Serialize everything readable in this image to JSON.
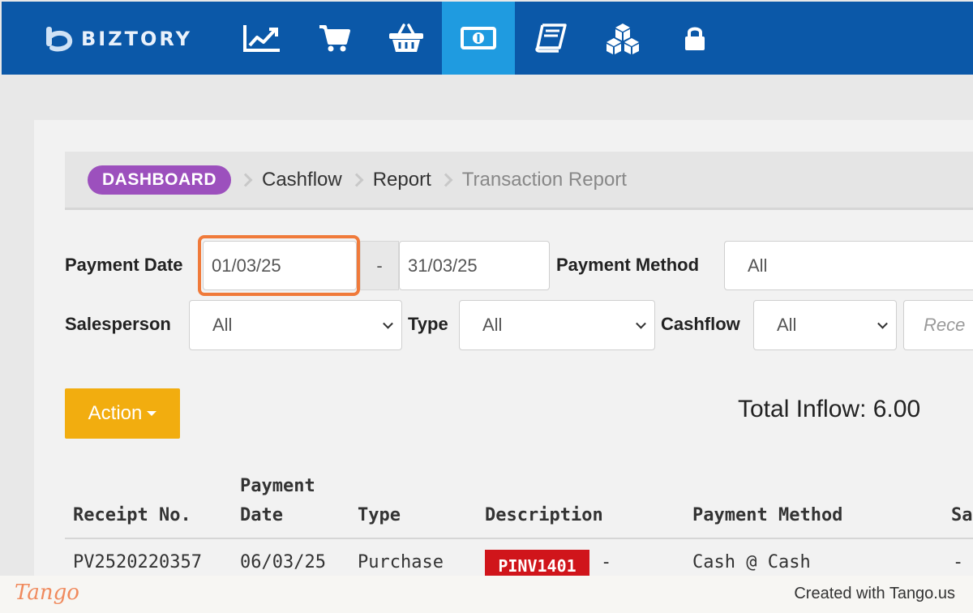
{
  "app": {
    "brand": "BIZTORY"
  },
  "nav": [
    {
      "icon": "chart-line-icon",
      "active": false
    },
    {
      "icon": "shopping-cart-icon",
      "active": false
    },
    {
      "icon": "basket-icon",
      "active": false
    },
    {
      "icon": "money-bill-icon",
      "active": true
    },
    {
      "icon": "book-icon",
      "active": false
    },
    {
      "icon": "cubes-icon",
      "active": false
    },
    {
      "icon": "lock-icon",
      "active": false
    }
  ],
  "breadcrumb": {
    "home": "DASHBOARD",
    "items": [
      "Cashflow",
      "Report"
    ],
    "current": "Transaction Report"
  },
  "filters": {
    "payment_date_label": "Payment Date",
    "date_from": "01/03/25",
    "date_separator": "-",
    "date_to": "31/03/25",
    "payment_method_label": "Payment Method",
    "payment_method_value": "All",
    "salesperson_label": "Salesperson",
    "salesperson_value": "All",
    "type_label": "Type",
    "type_value": "All",
    "cashflow_label": "Cashflow",
    "cashflow_value": "All",
    "receipt_placeholder": "Rece"
  },
  "actions": {
    "action_label": "Action"
  },
  "summary": {
    "total_inflow": "Total Inflow: 6.00"
  },
  "table": {
    "headers": {
      "receipt_no": "Receipt No.",
      "payment_date_1": "Payment",
      "payment_date_2": "Date",
      "type": "Type",
      "description": "Description",
      "payment_method": "Payment Method",
      "salesperson_partial": "Sa"
    },
    "rows": [
      {
        "receipt_no": "PV2520220357",
        "payment_date": "06/03/25",
        "type": "Purchase",
        "description_badge": "PINV1401",
        "description_text": "-",
        "payment_method": "Cash @ Cash",
        "salesperson": "-"
      }
    ]
  },
  "footer": {
    "logo": "Tango",
    "credit": "Created with Tango.us"
  },
  "colors": {
    "topbar": "#0b58a8",
    "nav_active": "#1f9be0",
    "dashboard_pill": "#9c50bd",
    "action_button": "#f2ad0f",
    "badge_red": "#d0151b",
    "highlight": "#f07a3a"
  }
}
